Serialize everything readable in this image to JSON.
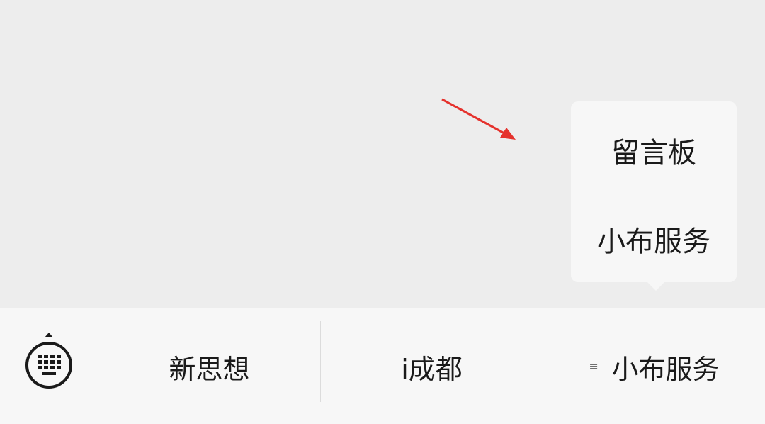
{
  "popup": {
    "items": [
      {
        "label": "留言板"
      },
      {
        "label": "小布服务"
      }
    ]
  },
  "menubar": {
    "keyboard_icon": "keyboard-icon",
    "items": [
      {
        "label": "新思想"
      },
      {
        "label": "i成都"
      },
      {
        "label": "小布服务",
        "icon": "submenu-icon"
      }
    ]
  },
  "colors": {
    "background": "#ededed",
    "menubar": "#f7f7f7",
    "popup": "#f7f7f7",
    "arrow": "#e5322d",
    "text": "#1a1a1a"
  }
}
